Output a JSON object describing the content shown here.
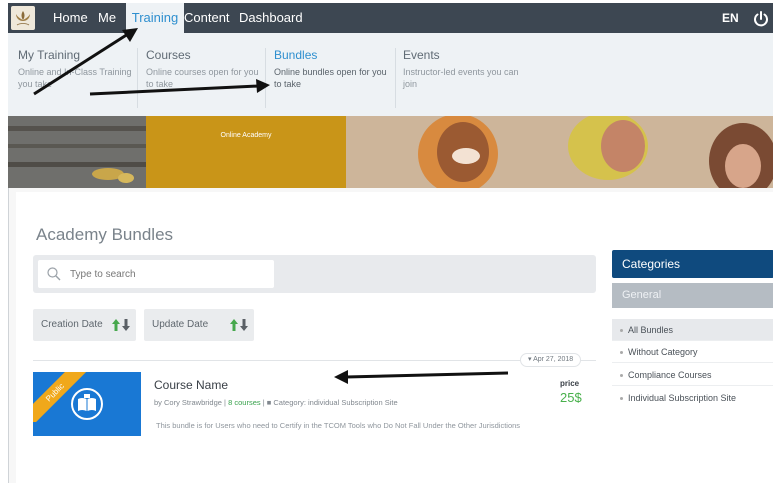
{
  "topnav": {
    "items": [
      {
        "label": "Home"
      },
      {
        "label": "Me"
      },
      {
        "label": "Training"
      },
      {
        "label": "Content"
      },
      {
        "label": "Dashboard"
      }
    ],
    "active": "Training",
    "language": "EN",
    "icons": {
      "logo": "lotus-logo-icon",
      "power": "power-icon"
    }
  },
  "megamenu": {
    "columns": [
      {
        "title": "My Training",
        "desc": "Online and In-Class Training you take"
      },
      {
        "title": "Courses",
        "desc": "Online courses open for you to take"
      },
      {
        "title": "Bundles",
        "desc": "Online bundles open for you to take"
      },
      {
        "title": "Events",
        "desc": "Instructor-led events you can join"
      }
    ],
    "active": "Bundles"
  },
  "banner": {
    "label": "Online Academy"
  },
  "main": {
    "title": "Academy Bundles",
    "search": {
      "placeholder": "Type to search",
      "value": ""
    },
    "sort_buttons": [
      {
        "label": "Creation Date"
      },
      {
        "label": "Update Date"
      }
    ]
  },
  "bundle": {
    "date": "Apr 27, 2018",
    "badge": "Public",
    "name": "Course Name",
    "author": "by Cory Strawbridge",
    "courses": "8 courses",
    "category": "Category: individual Subscription Site",
    "description": "This bundle is for Users who need to Certify in the TCOM Tools who Do Not Fall Under the Other Jurisdictions",
    "price_label": "price",
    "price": "25$"
  },
  "categories": {
    "header": "Categories",
    "group": "General",
    "items": [
      {
        "label": "All Bundles"
      },
      {
        "label": "Without Category"
      },
      {
        "label": "Compliance Courses"
      },
      {
        "label": "Individual Subscription Site"
      }
    ],
    "active": "All Bundles"
  },
  "colors": {
    "nav_bg": "#3d4752",
    "accent_blue": "#2e8fcf",
    "category_header": "#0f4a7e",
    "price_green": "#48b04b",
    "ribbon": "#f0a81b",
    "thumb_blue": "#1978d4",
    "annotation_arrow": "#111111"
  }
}
